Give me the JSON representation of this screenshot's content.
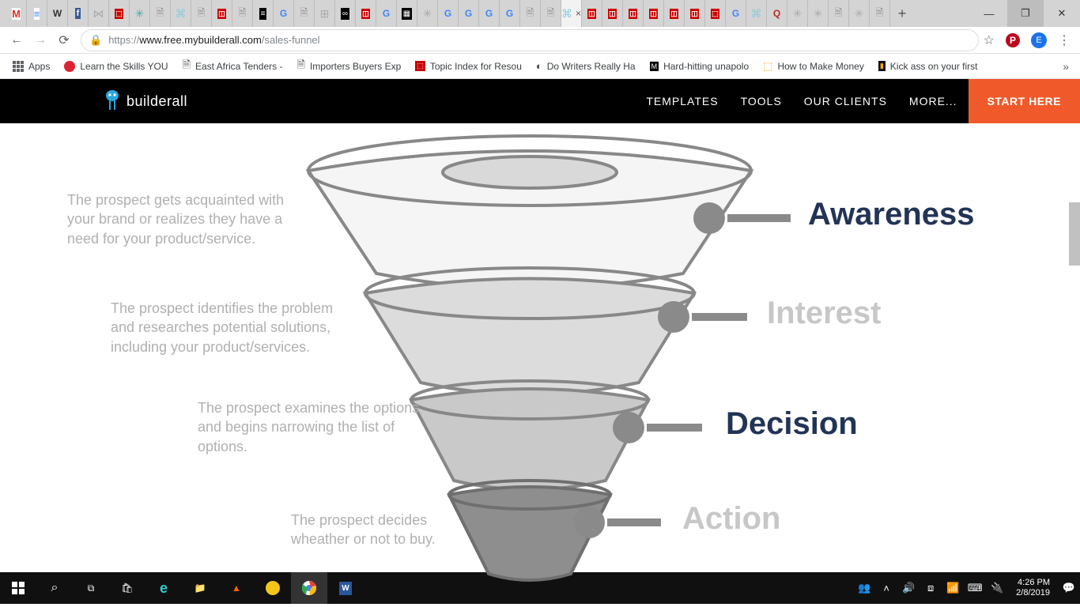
{
  "browser": {
    "url_prefix": "https://",
    "url_host": "www.free.mybuilderall.com",
    "url_path": "/sales-funnel",
    "bookmarks": {
      "apps": "Apps",
      "b1": "Learn the Skills YOU",
      "b2": "East Africa Tenders -",
      "b3": "Importers Buyers Exp",
      "b4": "Topic Index for Resou",
      "b5": "Do Writers Really Ha",
      "b6": "Hard-hitting unapolo",
      "b7": "How to Make Money",
      "b8": "Kick ass on your first"
    },
    "avatar_initial": "E",
    "pinterest_initial": "P"
  },
  "site": {
    "brand": "builderall",
    "nav": {
      "templates": "TEMPLATES",
      "tools": "TOOLS",
      "clients": "OUR CLIENTS",
      "more": "MORE...",
      "cta": "START HERE"
    }
  },
  "funnel": {
    "s1": {
      "label": "Awareness",
      "desc": "The prospect gets acquainted with your brand or realizes they have a need for your product/service."
    },
    "s2": {
      "label": "Interest",
      "desc": "The prospect identifies the problem and researches potential solutions, including your product/services."
    },
    "s3": {
      "label": "Decision",
      "desc": "The prospect examines the options and begins narrowing the list of options."
    },
    "s4": {
      "label": "Action",
      "desc": "The prospect decides wheather or not to buy."
    }
  },
  "os": {
    "time": "4:26 PM",
    "date": "2/8/2019"
  }
}
